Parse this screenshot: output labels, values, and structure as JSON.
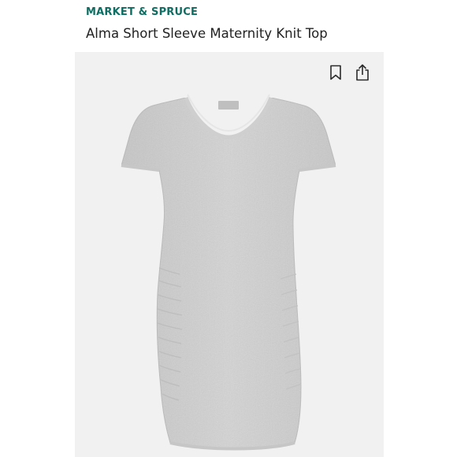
{
  "header": {
    "brand": "MARKET & SPRUCE",
    "title": "Alma Short Sleeve Maternity Knit Top"
  },
  "actions": [
    {
      "icon": "bookmark-icon"
    },
    {
      "icon": "share-icon"
    }
  ],
  "product": {
    "color": "heather grey",
    "fabric_hex": "#dcdcdc"
  },
  "colors": {
    "brand": "#0f6e63",
    "title": "#222222",
    "background": "#f1f1f1"
  }
}
